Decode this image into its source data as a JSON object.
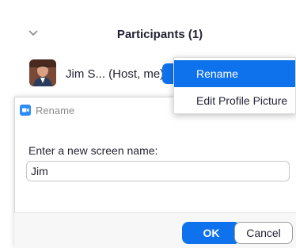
{
  "participants_panel": {
    "title": "Participants (1)",
    "collapse_icon": "chevron-down-icon",
    "participant": {
      "name": "Jim S... (Host, me)",
      "avatar": "avatar-photo"
    }
  },
  "context_menu": {
    "items": [
      {
        "label": "Rename",
        "highlighted": true
      },
      {
        "label": "Edit Profile Picture",
        "highlighted": false
      }
    ]
  },
  "rename_dialog": {
    "title": "Rename",
    "app_icon": "zoom-camera-icon",
    "prompt": "Enter a new screen name:",
    "input_value": "Jim",
    "ok_label": "OK",
    "cancel_label": "Cancel"
  },
  "colors": {
    "accent": "#0e72ed",
    "text": "#232333",
    "muted": "#8a8a8a"
  }
}
